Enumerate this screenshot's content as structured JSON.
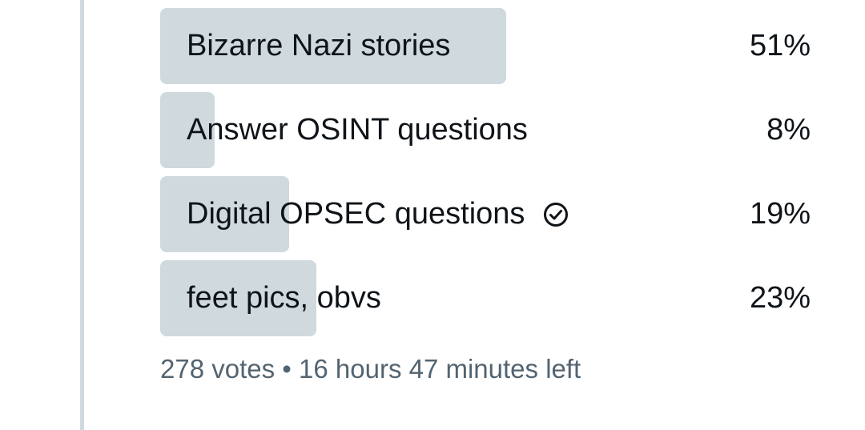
{
  "poll": {
    "options": [
      {
        "label": "Bizarre Nazi stories",
        "percent": 51,
        "percent_text": "51%",
        "selected": false
      },
      {
        "label": "Answer OSINT questions",
        "percent": 8,
        "percent_text": "8%",
        "selected": false
      },
      {
        "label": "Digital OPSEC questions",
        "percent": 19,
        "percent_text": "19%",
        "selected": true
      },
      {
        "label": "feet pics, obvs",
        "percent": 23,
        "percent_text": "23%",
        "selected": false
      }
    ],
    "votes_text": "278 votes",
    "separator": "•",
    "time_left_text": "16 hours 47 minutes left"
  },
  "colors": {
    "bar": "#cfd9de",
    "text": "#0f1419",
    "muted": "#536471",
    "thread_line": "#cfd9de"
  }
}
